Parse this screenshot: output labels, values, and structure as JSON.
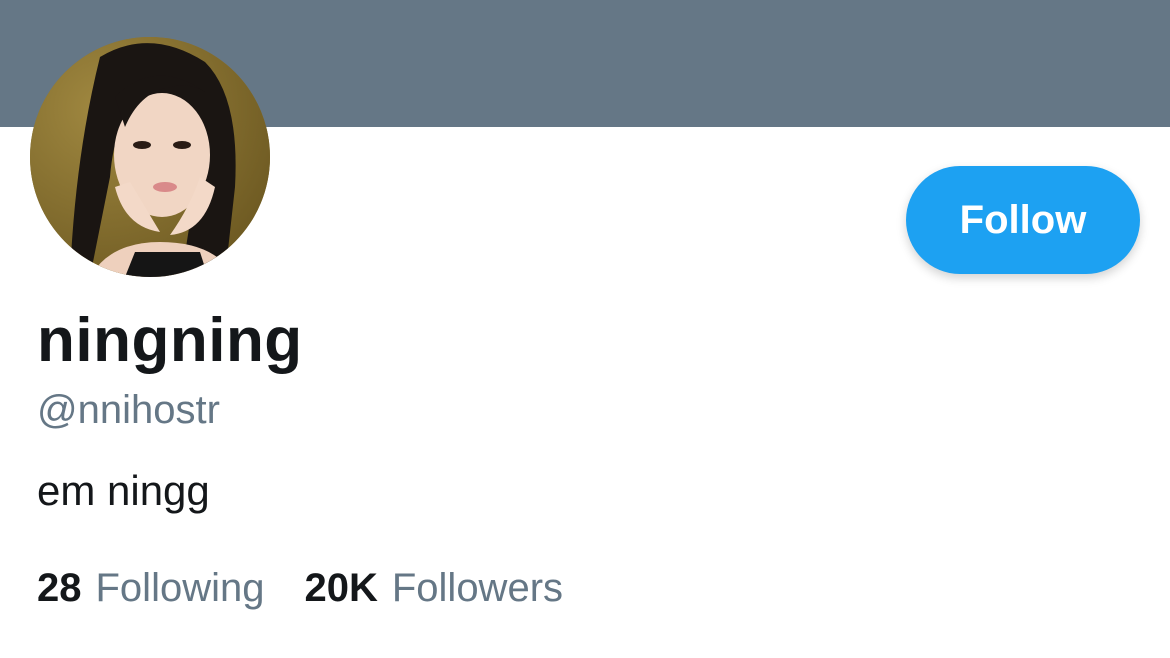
{
  "profile": {
    "banner_color": "#657786",
    "avatar": "profile-photo",
    "display_name": "ningning",
    "handle": "@nnihostr",
    "bio": "em ningg",
    "follow_label": "Follow",
    "accent_color": "#1da1f2",
    "stats": {
      "following_count": "28",
      "following_label": "Following",
      "followers_count": "20K",
      "followers_label": "Followers"
    }
  }
}
